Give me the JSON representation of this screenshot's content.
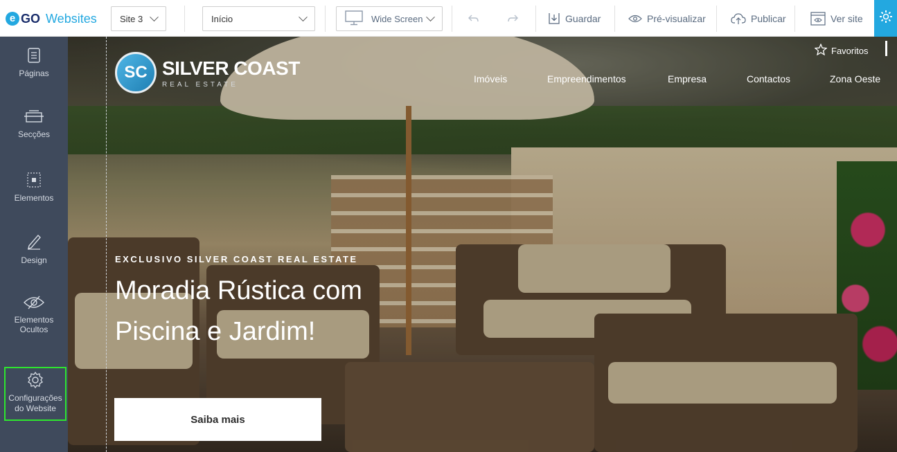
{
  "topbar": {
    "logo_mark": "e",
    "logo_go": "GO",
    "logo_websites": "Websites",
    "site_select": "Site 3",
    "page_select": "Início",
    "view_select": "Wide Screen",
    "save_label": "Guardar",
    "preview_label": "Pré-visualizar",
    "publish_label": "Publicar",
    "view_site_label": "Ver site",
    "accent_color": "#23a8e0"
  },
  "sidebar": {
    "items": [
      {
        "label": "Páginas",
        "icon": "pages-icon"
      },
      {
        "label": "Secções",
        "icon": "sections-icon"
      },
      {
        "label": "Elementos",
        "icon": "elements-icon"
      },
      {
        "label": "Design",
        "icon": "pencil-icon"
      },
      {
        "label": "Elementos Ocultos",
        "icon": "eye-off-icon"
      },
      {
        "label": "Configurações do Website",
        "icon": "gear-icon",
        "active": true
      }
    ],
    "bg_color": "#3f4a5c",
    "active_outline": "#2ee62e"
  },
  "site": {
    "brand_initials": "SC",
    "brand_name": "SILVER COAST",
    "brand_sub": "REAL ESTATE",
    "favorites_label": "Favoritos",
    "nav": [
      "Imóveis",
      "Empreendimentos",
      "Empresa",
      "Contactos",
      "Zona Oeste"
    ],
    "hero_kicker": "EXCLUSIVO SILVER COAST REAL ESTATE",
    "hero_title": "Moradia Rústica com Piscina e Jardim!",
    "hero_button": "Saiba mais"
  }
}
